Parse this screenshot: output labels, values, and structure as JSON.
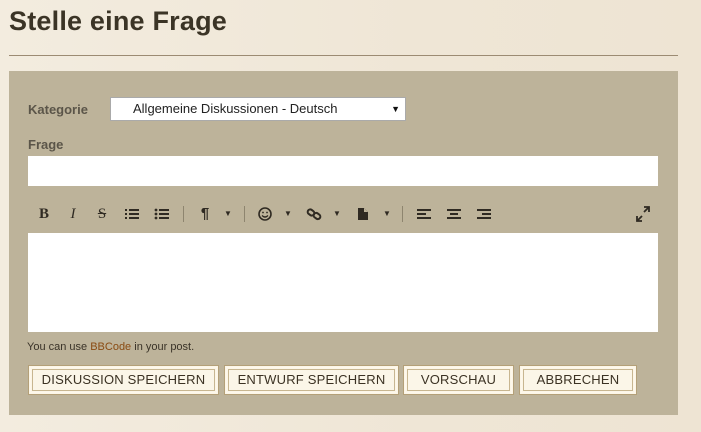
{
  "page": {
    "title": "Stelle eine Frage"
  },
  "form": {
    "category_label": "Kategorie",
    "category_value": "Allgemeine Diskussionen - Deutsch",
    "question_label": "Frage",
    "question_value": "",
    "body_value": ""
  },
  "toolbar": {
    "icons": [
      "bold-icon",
      "italic-icon",
      "strikethrough-icon",
      "ordered-list-icon",
      "bulleted-list-icon",
      "paragraph-format-icon",
      "emoji-icon",
      "link-icon",
      "insert-file-icon",
      "align-left-icon",
      "align-center-icon",
      "align-right-icon",
      "fullscreen-icon"
    ],
    "bold": "B",
    "italic": "I",
    "strike": "S",
    "paragraph": "¶",
    "caret": "▼"
  },
  "hint": {
    "prefix": "You can use ",
    "link": "BBCode",
    "suffix": " in your post."
  },
  "buttons": {
    "save_discussion": "DISKUSSION SPEICHERN",
    "save_draft": "ENTWURF SPEICHERN",
    "preview": "VORSCHAU",
    "cancel": "ABBRECHEN"
  }
}
